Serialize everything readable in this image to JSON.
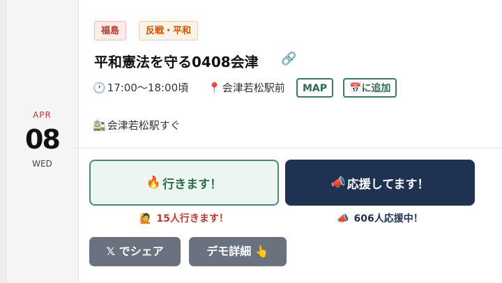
{
  "date": {
    "month": "APR",
    "day": "08",
    "weekday": "WED"
  },
  "tags": [
    {
      "label": "福島"
    },
    {
      "label": "反戦・平和"
    }
  ],
  "event": {
    "title": "平和憲法を守る0408会津",
    "link_icon": "🔗",
    "time_icon": "🕐",
    "time": "17:00〜18:00頃",
    "place_icon": "📍",
    "place": "会津若松駅前",
    "map_label": "MAP",
    "calendar_icon": "📅",
    "calendar_label": "に追加",
    "access_icon": "🚉",
    "access": "会津若松駅すぐ"
  },
  "actions": {
    "go_icon": "🔥",
    "go_label": "行きます！",
    "cheer_icon": "📣",
    "cheer_label": "応援してます！",
    "go_count_icon": "🙋",
    "go_count": "15人行きます！",
    "cheer_count_icon": "📣",
    "cheer_count": "606人応援中！",
    "share_label": "𝕏 でシェア",
    "detail_label": "デモ詳細",
    "detail_icon": "👆"
  },
  "colors": {
    "date_month": "#c0392b",
    "tag_region": "#c0392b",
    "tag_theme": "#d35400",
    "accent_green": "#2d6a4f",
    "navy": "#1f3251",
    "gray_button": "#6a7280"
  }
}
